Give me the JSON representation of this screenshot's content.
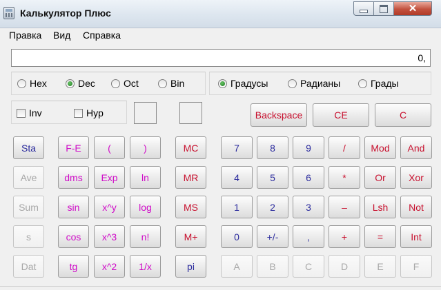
{
  "window": {
    "title": "Калькулятор Плюс",
    "close_glyph": "✕"
  },
  "menu": [
    "Правка",
    "Вид",
    "Справка"
  ],
  "display": {
    "value": "0,"
  },
  "base_modes": [
    "Hex",
    "Dec",
    "Oct",
    "Bin"
  ],
  "base_selected": "Dec",
  "angle_modes": [
    "Градусы",
    "Радианы",
    "Грады"
  ],
  "angle_selected": "Градусы",
  "checkboxes": [
    {
      "label": "Inv",
      "checked": false
    },
    {
      "label": "Hyp",
      "checked": false
    }
  ],
  "edit_buttons": [
    "Backspace",
    "CE",
    "C"
  ],
  "stat_buttons": [
    "Sta",
    "Ave",
    "Sum",
    "s",
    "Dat"
  ],
  "function_buttons": [
    [
      "F-E",
      "(",
      ")"
    ],
    [
      "dms",
      "Exp",
      "ln"
    ],
    [
      "sin",
      "x^y",
      "log"
    ],
    [
      "cos",
      "x^3",
      "n!"
    ],
    [
      "tg",
      "x^2",
      "1/x"
    ]
  ],
  "memory_buttons": [
    "MC",
    "MR",
    "MS",
    "M+",
    "pi"
  ],
  "keypad": [
    [
      "7",
      "8",
      "9",
      "/",
      "Mod",
      "And"
    ],
    [
      "4",
      "5",
      "6",
      "*",
      "Or",
      "Xor"
    ],
    [
      "1",
      "2",
      "3",
      "–",
      "Lsh",
      "Not"
    ],
    [
      "0",
      "+/-",
      ",",
      "+",
      "=",
      "Int"
    ],
    [
      "A",
      "B",
      "C",
      "D",
      "E",
      "F"
    ]
  ],
  "colors": {
    "blue": "#2c2c9e",
    "red": "#c8102e",
    "magenta": "#d00cc8",
    "disabled": "#a8a8a8"
  },
  "icons": {
    "app": "calculator-icon",
    "min": "minimize-icon",
    "max": "maximize-icon",
    "close": "close-icon"
  }
}
